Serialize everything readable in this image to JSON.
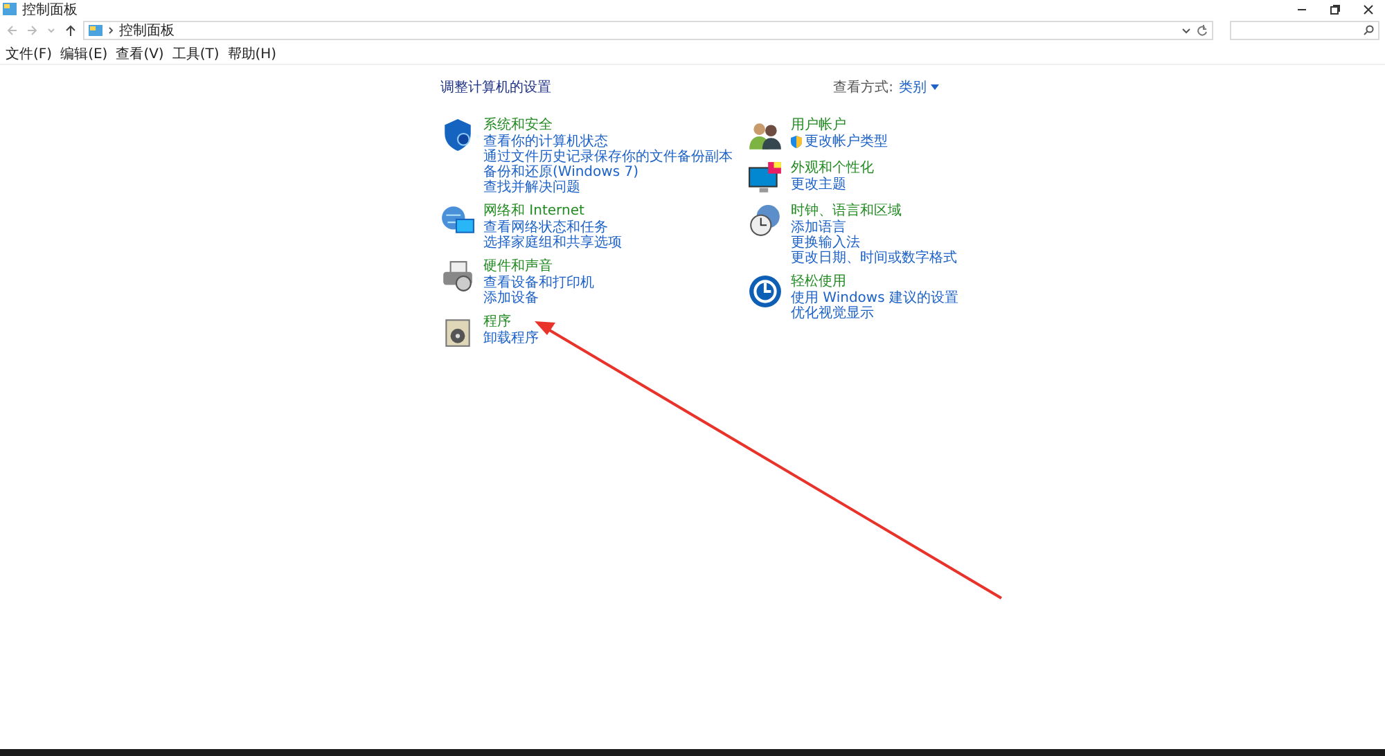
{
  "window": {
    "title": "控制面板"
  },
  "address": {
    "path": "控制面板"
  },
  "menu": [
    "文件(F)",
    "编辑(E)",
    "查看(V)",
    "工具(T)",
    "帮助(H)"
  ],
  "heading": "调整计算机的设置",
  "view_by": {
    "label": "查看方式:",
    "value": "类别"
  },
  "columns": [
    [
      {
        "kind": "security",
        "title": "系统和安全",
        "links": [
          {
            "kind": "plain",
            "text": "查看你的计算机状态"
          },
          {
            "kind": "plain",
            "text": "通过文件历史记录保存你的文件备份副本"
          },
          {
            "kind": "plain",
            "text": "备份和还原(Windows 7)"
          },
          {
            "kind": "plain",
            "text": "查找并解决问题"
          }
        ]
      },
      {
        "kind": "network",
        "title": "网络和 Internet",
        "links": [
          {
            "kind": "plain",
            "text": "查看网络状态和任务"
          },
          {
            "kind": "plain",
            "text": "选择家庭组和共享选项"
          }
        ]
      },
      {
        "kind": "hardware",
        "title": "硬件和声音",
        "links": [
          {
            "kind": "plain",
            "text": "查看设备和打印机"
          },
          {
            "kind": "plain",
            "text": "添加设备"
          }
        ]
      },
      {
        "kind": "programs",
        "title": "程序",
        "links": [
          {
            "kind": "plain",
            "text": "卸载程序"
          }
        ]
      }
    ],
    [
      {
        "kind": "users",
        "title": "用户帐户",
        "links": [
          {
            "kind": "admin",
            "text": "更改帐户类型"
          }
        ]
      },
      {
        "kind": "appearance",
        "title": "外观和个性化",
        "links": [
          {
            "kind": "plain",
            "text": "更改主题"
          }
        ]
      },
      {
        "kind": "clock",
        "title": "时钟、语言和区域",
        "links": [
          {
            "kind": "plain",
            "text": "添加语言"
          },
          {
            "kind": "plain",
            "text": "更换输入法"
          },
          {
            "kind": "plain",
            "text": "更改日期、时间或数字格式"
          }
        ]
      },
      {
        "kind": "access",
        "title": "轻松使用",
        "links": [
          {
            "kind": "plain",
            "text": "使用 Windows 建议的设置"
          },
          {
            "kind": "plain",
            "text": "优化视觉显示"
          }
        ]
      }
    ]
  ]
}
